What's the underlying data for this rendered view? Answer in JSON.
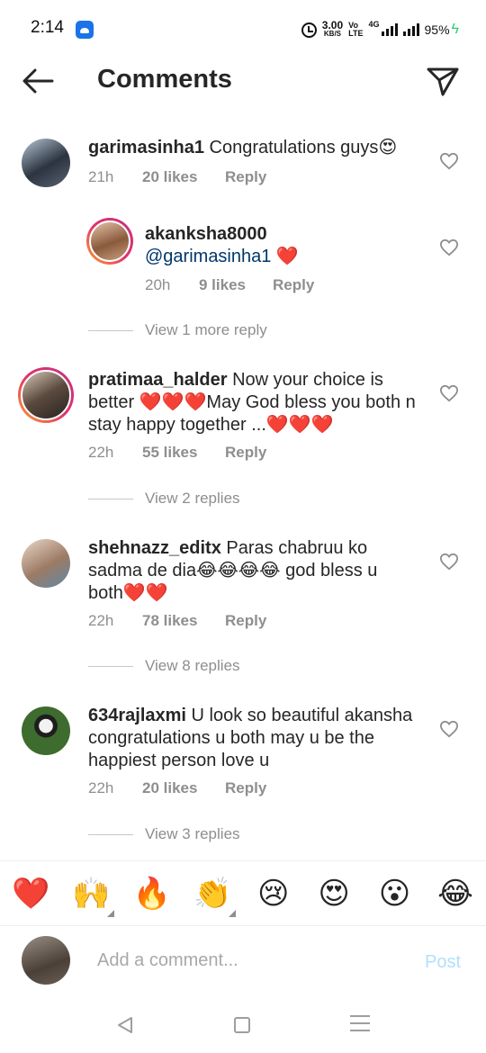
{
  "status_bar": {
    "time": "2:14",
    "net_speed_value": "3.00",
    "net_speed_unit": "KB/S",
    "volte_top": "Vo",
    "volte_bottom": "LTE",
    "network": "4G",
    "battery": "95%"
  },
  "header": {
    "title": "Comments",
    "back_icon": "arrow-left-icon",
    "send_icon": "paper-plane-icon"
  },
  "comments": [
    {
      "username": "garimasinha1",
      "text": " Congratulations guys😍",
      "time": "21h",
      "likes": "20 likes",
      "reply": "Reply"
    },
    {
      "username": "akanksha8000",
      "mention": "@garimasinha1",
      "text": " ❤️",
      "time": "20h",
      "likes": "9 likes",
      "reply": "Reply",
      "view_replies": "View 1 more reply"
    },
    {
      "username": "pratimaa_halder",
      "text": " Now your  choice is better ❤️❤️❤️May God bless you both n stay happy together ...❤️❤️❤️",
      "time": "22h",
      "likes": "55 likes",
      "reply": "Reply",
      "view_replies": "View 2 replies"
    },
    {
      "username": "shehnazz_editx",
      "text": " Paras chabruu ko sadma de dia😂😂😂😂 god bless u both❤️❤️",
      "time": "22h",
      "likes": "78 likes",
      "reply": "Reply",
      "view_replies": "View 8 replies"
    },
    {
      "username": "634rajlaxmi",
      "text": " U look so beautiful akansha congratulations u both may u be the happiest person love u",
      "time": "22h",
      "likes": "20 likes",
      "reply": "Reply",
      "view_replies": "View 3 replies"
    }
  ],
  "emoji_bar": [
    "❤️",
    "🙌",
    "🔥",
    "👏",
    "😢",
    "😍",
    "😮",
    "😂"
  ],
  "add_comment": {
    "placeholder": "Add a comment...",
    "post_label": "Post"
  },
  "colors": {
    "text": "#262626",
    "secondary": "#8e8e8e",
    "mention": "#00376b",
    "post_disabled": "#b2dffc",
    "story_ring": "#e1306c"
  }
}
